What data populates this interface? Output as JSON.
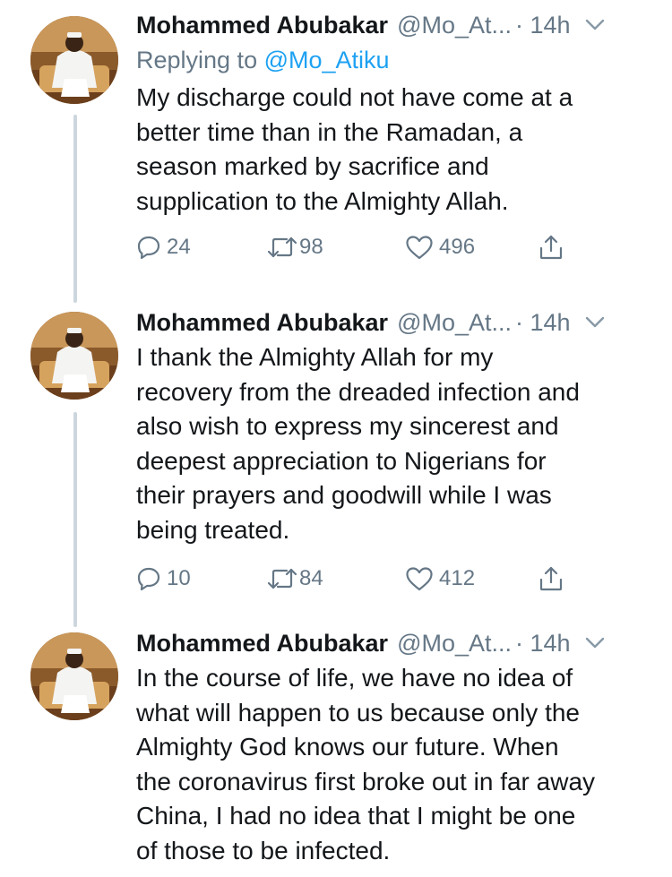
{
  "tweets": [
    {
      "name": "Mohammed Abubakar",
      "handle": "@Mo_At...",
      "time": "· 14h",
      "replying_prefix": "Replying to ",
      "replying_to": "@Mo_Atiku",
      "text": "My discharge could not have come at a\nbetter time than in the Ramadan, a\nseason marked by sacrifice and\nsupplication to the Almighty Allah.",
      "replies": "24",
      "retweets": "98",
      "likes": "496"
    },
    {
      "name": "Mohammed Abubakar",
      "handle": "@Mo_At...",
      "time": "· 14h",
      "text": "I thank the Almighty Allah for my\nrecovery from the dreaded infection and\nalso wish to express my sincerest and\ndeepest appreciation to Nigerians for\ntheir prayers and goodwill while I was\nbeing treated.",
      "replies": "10",
      "retweets": "84",
      "likes": "412"
    },
    {
      "name": "Mohammed Abubakar",
      "handle": "@Mo_At...",
      "time": "· 14h",
      "text": "In the course of life, we have no idea of\nwhat will happen to us because only the\nAlmighty God knows our future. When\nthe coronavirus first broke out in far away\nChina, I had no idea that I might be one\nof those to be infected."
    }
  ],
  "icons": {
    "reply": "reply-icon",
    "retweet": "retweet-icon",
    "like": "heart-icon",
    "share": "share-icon",
    "more": "chevron-down-icon"
  },
  "colors": {
    "text": "#14171a",
    "secondary": "#657786",
    "link": "#1da1f2",
    "thread_line": "#ccd6dd"
  }
}
